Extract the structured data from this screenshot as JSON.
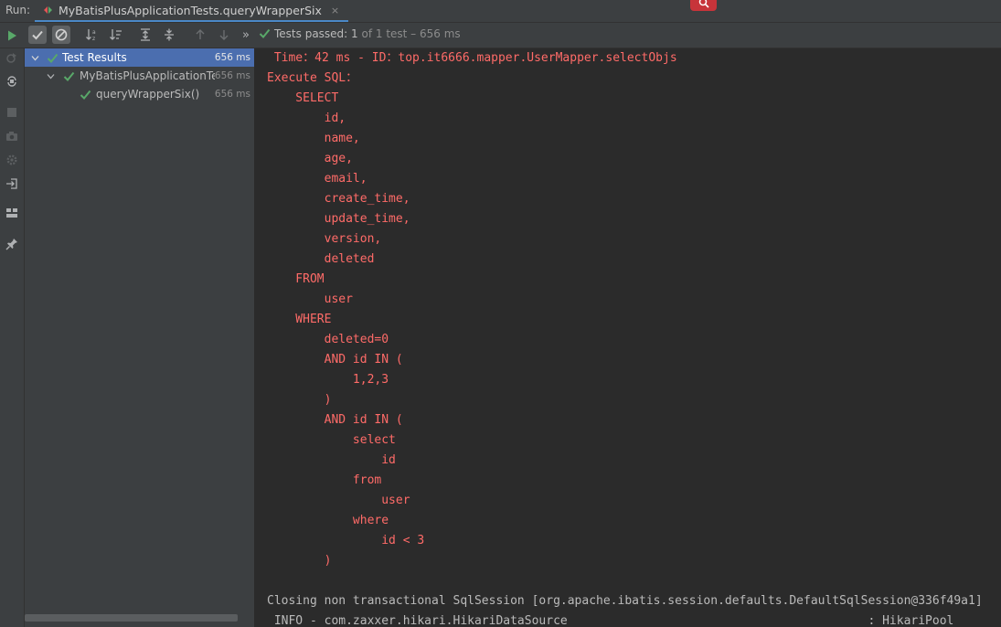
{
  "run_bar": {
    "label": "Run:",
    "tab_title": "MyBatisPlusApplicationTests.queryWrapperSix",
    "tab_close": "×"
  },
  "toolbar": {
    "more": "»",
    "status_prefix": "Tests passed: ",
    "status_passed": "1",
    "status_rest": " of 1 test – 656 ms"
  },
  "tree": {
    "items": [
      {
        "label": "Test Results",
        "duration": "656 ms",
        "selected": true
      },
      {
        "label": "MyBatisPlusApplicationTe",
        "duration": "656 ms",
        "selected": false
      },
      {
        "label": "queryWrapperSix()",
        "duration": "656 ms",
        "selected": false
      }
    ]
  },
  "console": {
    "lines": [
      {
        "text": " Time：42 ms - ID：top.it6666.mapper.UserMapper.selectObjs",
        "style": "err"
      },
      {
        "text": "Execute SQL：",
        "style": "err"
      },
      {
        "text": "    SELECT",
        "style": "err"
      },
      {
        "text": "        id,",
        "style": "err"
      },
      {
        "text": "        name,",
        "style": "err"
      },
      {
        "text": "        age,",
        "style": "err"
      },
      {
        "text": "        email,",
        "style": "err"
      },
      {
        "text": "        create_time,",
        "style": "err"
      },
      {
        "text": "        update_time,",
        "style": "err"
      },
      {
        "text": "        version,",
        "style": "err"
      },
      {
        "text": "        deleted",
        "style": "err"
      },
      {
        "text": "    FROM",
        "style": "err"
      },
      {
        "text": "        user",
        "style": "err"
      },
      {
        "text": "    WHERE",
        "style": "err"
      },
      {
        "text": "        deleted=0",
        "style": "err"
      },
      {
        "text": "        AND id IN (",
        "style": "err"
      },
      {
        "text": "            1,2,3",
        "style": "err"
      },
      {
        "text": "        )",
        "style": "err"
      },
      {
        "text": "        AND id IN (",
        "style": "err"
      },
      {
        "text": "            select",
        "style": "err"
      },
      {
        "text": "                id",
        "style": "err"
      },
      {
        "text": "            from",
        "style": "err"
      },
      {
        "text": "                user",
        "style": "err"
      },
      {
        "text": "            where",
        "style": "err"
      },
      {
        "text": "                id < 3",
        "style": "err"
      },
      {
        "text": "        )",
        "style": "err"
      },
      {
        "text": "",
        "style": "norm"
      },
      {
        "text": "Closing non transactional SqlSession [org.apache.ibatis.session.defaults.DefaultSqlSession@336f49a1]",
        "style": "norm"
      },
      {
        "text": " INFO - com.zaxxer.hikari.HikariDataSource                                          : HikariPool",
        "style": "cut"
      }
    ]
  },
  "colors": {
    "error_text": "#ff6b68",
    "normal_text": "#bbbbbb",
    "pass_green": "#59a869",
    "selection": "#4b6eaf"
  }
}
